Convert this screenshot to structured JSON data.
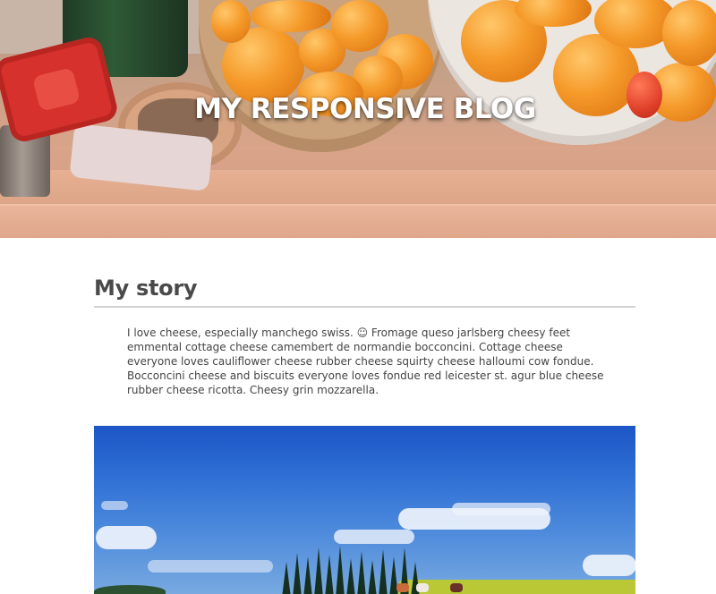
{
  "blog": {
    "title": "MY RESPONSIVE BLOG"
  },
  "post": {
    "heading": "My story",
    "body": "I love cheese, especially manchego swiss. ☺ Fromage queso jarlsberg cheesy feet emmental cottage cheese camembert de normandie bocconcini. Cottage cheese everyone loves cauliflower cheese rubber cheese squirty cheese halloumi cow fondue. Bocconcini cheese and biscuits everyone loves fondue red leicester st. agur blue cheese rubber cheese ricotta. Cheesy grin mozzarella."
  },
  "colors": {
    "heading_text": "#4a4a4a",
    "divider": "#d2d2d2",
    "hero_title": "#ffffff"
  }
}
